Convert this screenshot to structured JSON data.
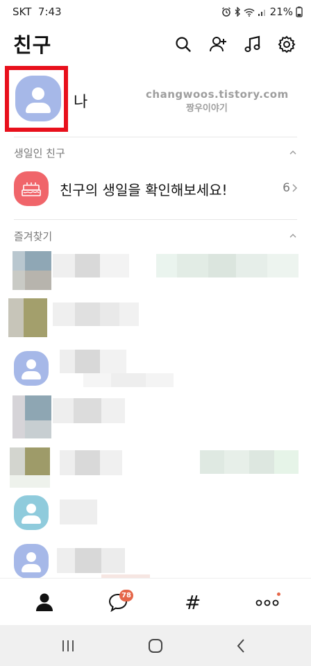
{
  "status": {
    "carrier": "SKT",
    "time": "7:43",
    "battery": "21%"
  },
  "header": {
    "title": "친구",
    "icons": [
      "search-icon",
      "add-friend-icon",
      "music-icon",
      "settings-icon"
    ]
  },
  "profile": {
    "name": "나",
    "watermark_line1": "changwoos.tistory.com",
    "watermark_line2": "짱우이야기",
    "avatar_color": "#a6b8e8",
    "highlight_color": "#e8101c"
  },
  "birthday_section": {
    "title": "생일인 친구",
    "row_text": "친구의 생일을 확인해보세요!",
    "count": "6",
    "icon_color": "#f0656a"
  },
  "favorites_section": {
    "title": "즐겨찾기"
  },
  "tabbar": {
    "tabs": [
      "friends-tab",
      "chats-tab",
      "hashtag-tab",
      "more-tab"
    ],
    "chat_badge": "78",
    "hashtag_symbol": "#"
  },
  "navbar": {
    "buttons": [
      "recent-apps-button",
      "home-button",
      "back-button"
    ]
  }
}
